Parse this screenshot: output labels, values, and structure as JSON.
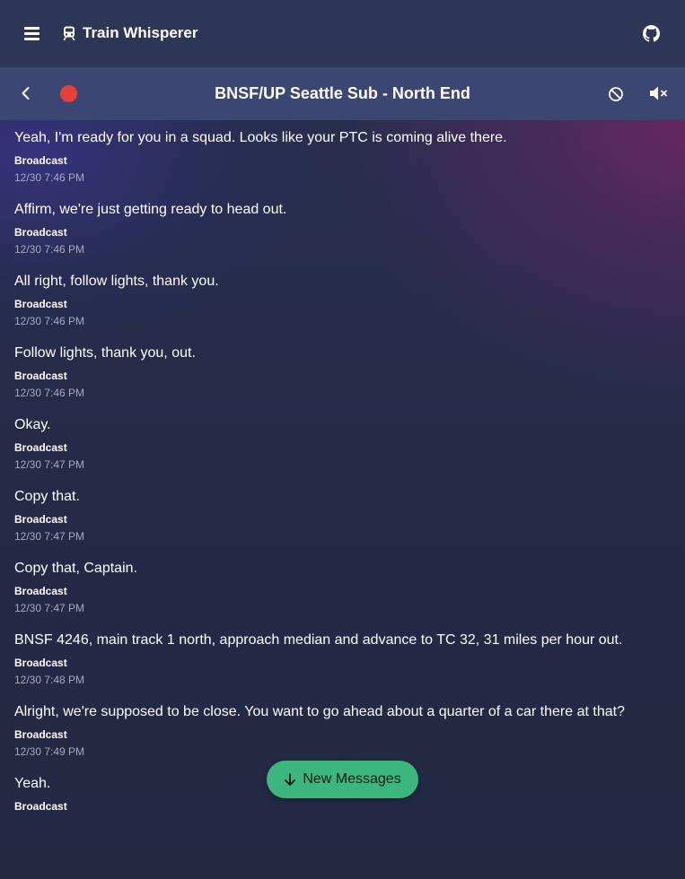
{
  "app": {
    "title": "Train Whisperer",
    "icons": [
      "menu-icon",
      "train-icon",
      "github-icon"
    ]
  },
  "channel": {
    "title": "BNSF/UP Seattle Sub - North End",
    "recording_color": "#e5403c",
    "icons": [
      "back-icon",
      "record-icon",
      "block-icon",
      "mute-icon"
    ]
  },
  "messages": [
    {
      "text": "Yeah, I'm ready for you in a squad. Looks like your PTC is coming alive there.",
      "sender": "Broadcast",
      "time": "12/30 7:46 PM"
    },
    {
      "text": "Affirm, we're just getting ready to head out.",
      "sender": "Broadcast",
      "time": "12/30 7:46 PM"
    },
    {
      "text": "All right, follow lights, thank you.",
      "sender": "Broadcast",
      "time": "12/30 7:46 PM"
    },
    {
      "text": "Follow lights, thank you, out.",
      "sender": "Broadcast",
      "time": "12/30 7:46 PM"
    },
    {
      "text": "Okay.",
      "sender": "Broadcast",
      "time": "12/30 7:47 PM"
    },
    {
      "text": "Copy that.",
      "sender": "Broadcast",
      "time": "12/30 7:47 PM"
    },
    {
      "text": "Copy that, Captain.",
      "sender": "Broadcast",
      "time": "12/30 7:47 PM"
    },
    {
      "text": "BNSF 4246, main track 1 north, approach median and advance to TC 32, 31 miles per hour out.",
      "sender": "Broadcast",
      "time": "12/30 7:48 PM"
    },
    {
      "text": "Alright, we're supposed to be close. You want to go ahead about a quarter of a car there at that?",
      "sender": "Broadcast",
      "time": "12/30 7:49 PM"
    },
    {
      "text": "Yeah.",
      "sender": "Broadcast",
      "time": ""
    }
  ],
  "new_messages_button": {
    "label": "New Messages",
    "icon": "arrow-down-icon",
    "color": "#3bb77e"
  }
}
